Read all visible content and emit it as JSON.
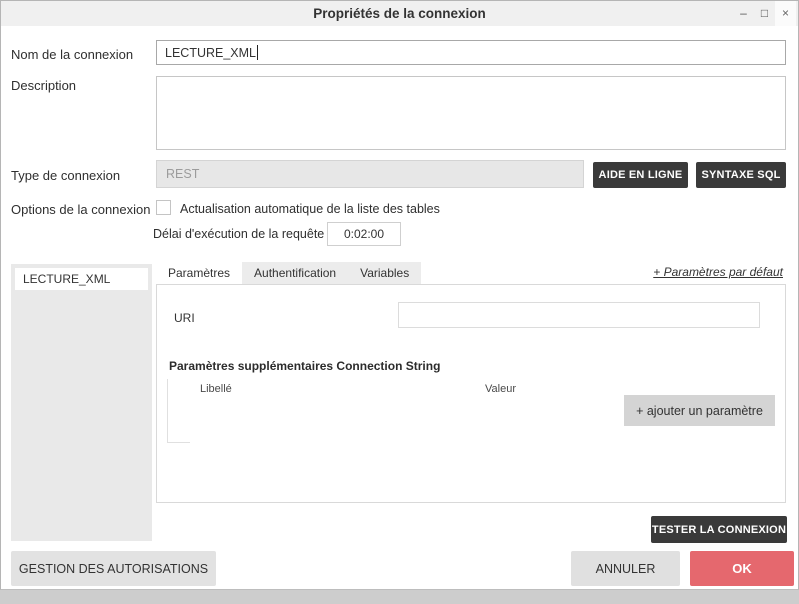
{
  "window": {
    "title": "Propriétés de la connexion",
    "controls": {
      "minimize": "–",
      "maximize": "□",
      "close": "×"
    }
  },
  "form": {
    "name_label": "Nom de la connexion",
    "name_value": "LECTURE_XML",
    "description_label": "Description",
    "description_value": "",
    "type_label": "Type de connexion",
    "type_value": "REST",
    "help_button": "AIDE EN LIGNE",
    "syntax_button": "SYNTAXE SQL",
    "options_label": "Options de la connexion",
    "auto_refresh_label": "Actualisation automatique de la liste des tables",
    "auto_refresh_checked": false,
    "timeout_label": "Délai d'exécution de la requête",
    "timeout_value": "0:02:00"
  },
  "connection_list": {
    "items": [
      {
        "label": "LECTURE_XML",
        "selected": true
      }
    ]
  },
  "tab_bar": {
    "tabs": [
      {
        "label": "Paramètres",
        "active": true
      },
      {
        "label": "Authentification",
        "active": false
      },
      {
        "label": "Variables",
        "active": false
      }
    ],
    "default_params_link": "+ Paramètres par défaut"
  },
  "parameters_tab": {
    "uri_label": "URI",
    "uri_value": "",
    "extra_params_title": "Paramètres supplémentaires Connection String",
    "column_label": "Libellé",
    "column_value": "Valeur",
    "add_param_button": "+ ajouter un paramètre"
  },
  "footer": {
    "test_button": "TESTER LA CONNEXION",
    "permissions_button": "GESTION DES AUTORISATIONS",
    "cancel_button": "ANNULER",
    "ok_button": "OK"
  },
  "colors": {
    "accent_red": "#e5686e",
    "dark_button": "#3a3a3a",
    "titlebar": "#f0f0f0",
    "panel_gray": "#e9e9e9"
  }
}
